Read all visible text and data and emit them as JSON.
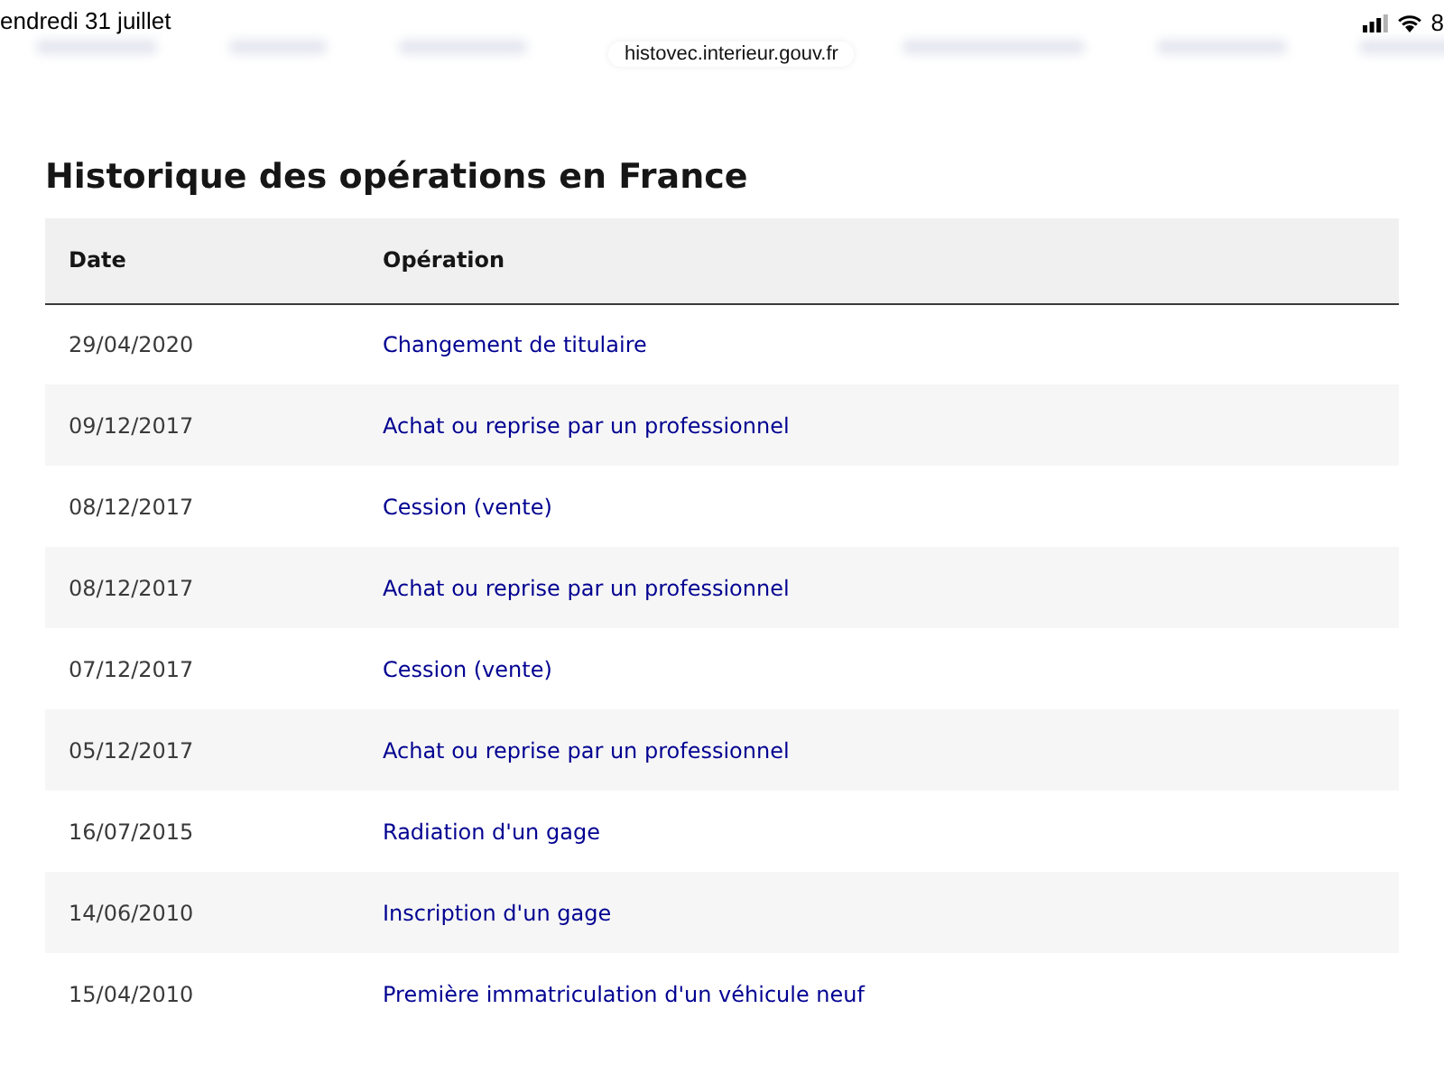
{
  "status_bar": {
    "time": "endredi 31 juillet",
    "url": "histovec.interieur.gouv.fr",
    "battery": "8"
  },
  "title": "Historique des opérations en France",
  "table": {
    "columns": [
      "Date",
      "Opération"
    ],
    "rows": [
      {
        "date": "29/04/2020",
        "operation": "Changement de titulaire"
      },
      {
        "date": "09/12/2017",
        "operation": "Achat ou reprise par un professionnel"
      },
      {
        "date": "08/12/2017",
        "operation": "Cession (vente)"
      },
      {
        "date": "08/12/2017",
        "operation": "Achat ou reprise par un professionnel"
      },
      {
        "date": "07/12/2017",
        "operation": "Cession (vente)"
      },
      {
        "date": "05/12/2017",
        "operation": "Achat ou reprise par un professionnel"
      },
      {
        "date": "16/07/2015",
        "operation": "Radiation d'un gage"
      },
      {
        "date": "14/06/2010",
        "operation": "Inscription d'un gage"
      },
      {
        "date": "15/04/2010",
        "operation": "Première immatriculation d'un véhicule neuf"
      }
    ]
  }
}
